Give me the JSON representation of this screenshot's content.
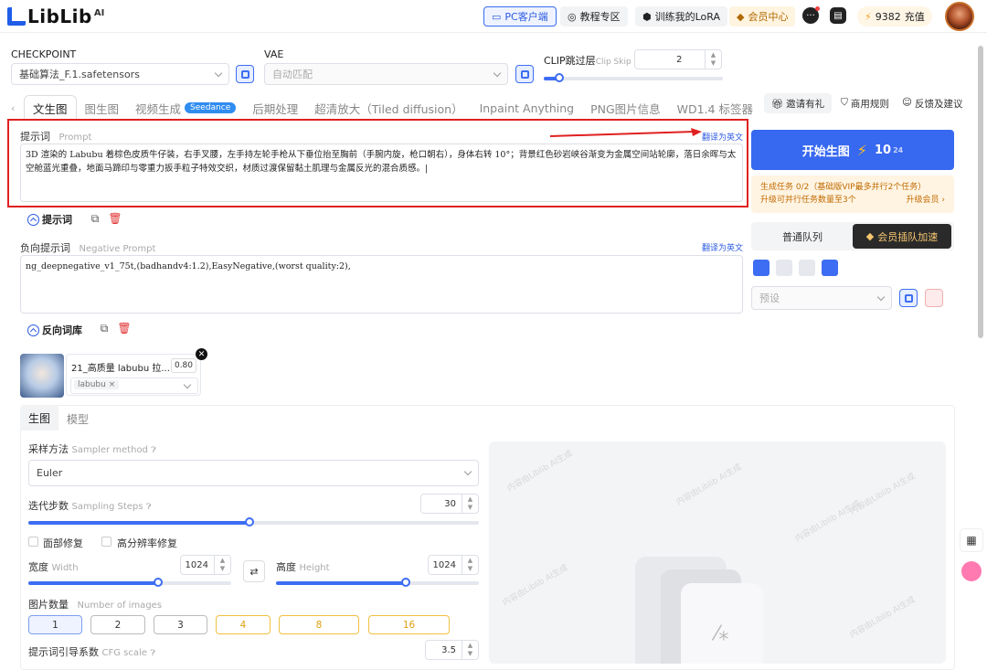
{
  "topbar": {
    "logo": "LibLib",
    "logo_sup": "AI",
    "pc_client": "PC客户端",
    "tutorial": "教程专区",
    "train_lora": "训练我的LoRA",
    "vip_center": "会员中心",
    "points": "9382",
    "charge": "充值"
  },
  "checkpoint": {
    "label": "CHECKPOINT",
    "value": "基础算法_F.1.safetensors"
  },
  "vae": {
    "label": "VAE",
    "placeholder": "自动匹配"
  },
  "clip": {
    "label": "CLIP跳过层",
    "label_en": "Clip Skip",
    "value": "2",
    "level": 0.08
  },
  "tabs": [
    {
      "label": "文生图"
    },
    {
      "label": "图生图"
    },
    {
      "label": "视频生成",
      "badge": "Seedance"
    },
    {
      "label": "后期处理"
    },
    {
      "label": "超清放大（Tiled diffusion）"
    },
    {
      "label": "Inpaint Anything"
    },
    {
      "label": "PNG图片信息"
    },
    {
      "label": "WD1.4 标签器"
    }
  ],
  "right_links": {
    "invite": "邀请有礼",
    "commercial": "商用规则",
    "feedback": "反馈及建议"
  },
  "prompt": {
    "label": "提示词",
    "label_en": "Prompt",
    "translate": "翻译为英文",
    "text": "3D 渲染的 Labubu 着棕色皮质牛仔装，右手叉腰，左手持左轮手枪从下垂位抬至胸前（手腕内旋，枪口朝右），身体右转 10°；背景红色砂岩峡谷渐变为金属空间站轮廓，落日余晖与太空舱蓝光重叠，地面马蹄印与零重力扳手粒子特效交织，材质过渡保留黏土肌理与金属反光的混合质感。|",
    "toggle": "提示词"
  },
  "negative": {
    "label": "负向提示词",
    "label_en": "Negative Prompt",
    "translate": "翻译为英文",
    "text": "ng_deepnegative_v1_75t,(badhandv4:1.2),EasyNegative,(worst quality:2),",
    "toggle": "反向词库"
  },
  "lora": {
    "name": "21_高质量 labubu 拉...",
    "weight": "0.80",
    "tag": "labubu",
    "tag_x": "×"
  },
  "panel_tabs": {
    "gen": "生图",
    "model": "模型"
  },
  "sampler": {
    "label": "采样方法",
    "label_en": "Sampler method",
    "value": "Euler"
  },
  "steps": {
    "label": "迭代步数",
    "label_en": "Sampling Steps",
    "value": "30",
    "level": 0.49
  },
  "face_fix": "面部修复",
  "hires_fix": "高分辨率修复",
  "width": {
    "label": "宽度",
    "label_en": "Width",
    "value": "1024",
    "level": 0.64
  },
  "height": {
    "label": "高度",
    "label_en": "Height",
    "value": "1024",
    "level": 0.64
  },
  "image_count": {
    "label": "图片数量",
    "label_en": "Number of images",
    "options": [
      "1",
      "2",
      "3",
      "4",
      "8",
      "16"
    ],
    "selected": "1"
  },
  "cfg": {
    "label": "提示词引导系数",
    "label_en": "CFG scale",
    "value": "3.5"
  },
  "watermark": "内容由Liblib AI生成",
  "generate": {
    "label": "开始生图",
    "cost": "10",
    "cost_small": "24"
  },
  "task_info": {
    "line1": "生成任务 0/2（基础版VIP最多并行2个任务）",
    "line2": "升级可并行任务数量至3个",
    "upgrade": "升级会员 ›"
  },
  "queue": {
    "normal": "普通队列",
    "vip": "会员插队加速"
  },
  "preset": {
    "placeholder": "预设"
  },
  "colors": {
    "accent": "#3768f0",
    "highlight_box": "#e02020",
    "gold": "#f0c040"
  }
}
